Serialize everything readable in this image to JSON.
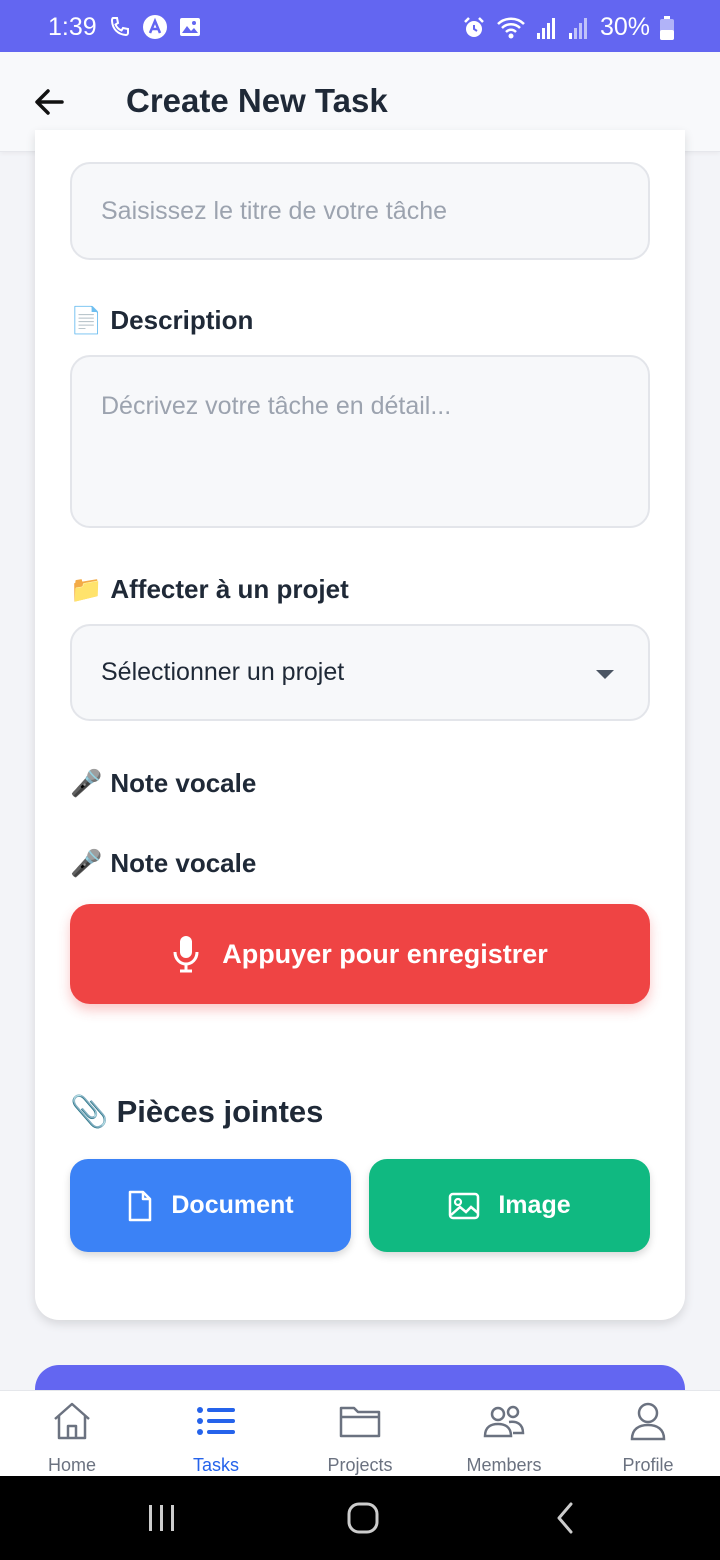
{
  "status_bar": {
    "time": "1:39",
    "battery": "30%"
  },
  "header": {
    "title": "Create New Task"
  },
  "form": {
    "title_placeholder": "Saisissez le titre de votre tâche",
    "description_label": "Description",
    "description_icon": "📄",
    "description_placeholder": "Décrivez votre tâche en détail...",
    "project_label": "Affecter à un projet",
    "project_icon": "📁",
    "project_selected": "Sélectionner un projet",
    "voice_note_label_1": "Note vocale",
    "voice_note_label_2": "Note vocale",
    "voice_icon": "🎤",
    "record_button": "Appuyer pour enregistrer",
    "attachments_label": "Pièces jointes",
    "attachments_icon": "📎",
    "document_button": "Document",
    "image_button": "Image"
  },
  "tabs": [
    {
      "label": "Home",
      "icon": "home-icon",
      "active": false
    },
    {
      "label": "Tasks",
      "icon": "list-icon",
      "active": true
    },
    {
      "label": "Projects",
      "icon": "folder-icon",
      "active": false
    },
    {
      "label": "Members",
      "icon": "users-icon",
      "active": false
    },
    {
      "label": "Profile",
      "icon": "user-icon",
      "active": false
    }
  ],
  "colors": {
    "primary": "#6366f1",
    "record": "#ef4444",
    "document": "#3b82f6",
    "image": "#10b981",
    "active_tab": "#2563eb"
  }
}
